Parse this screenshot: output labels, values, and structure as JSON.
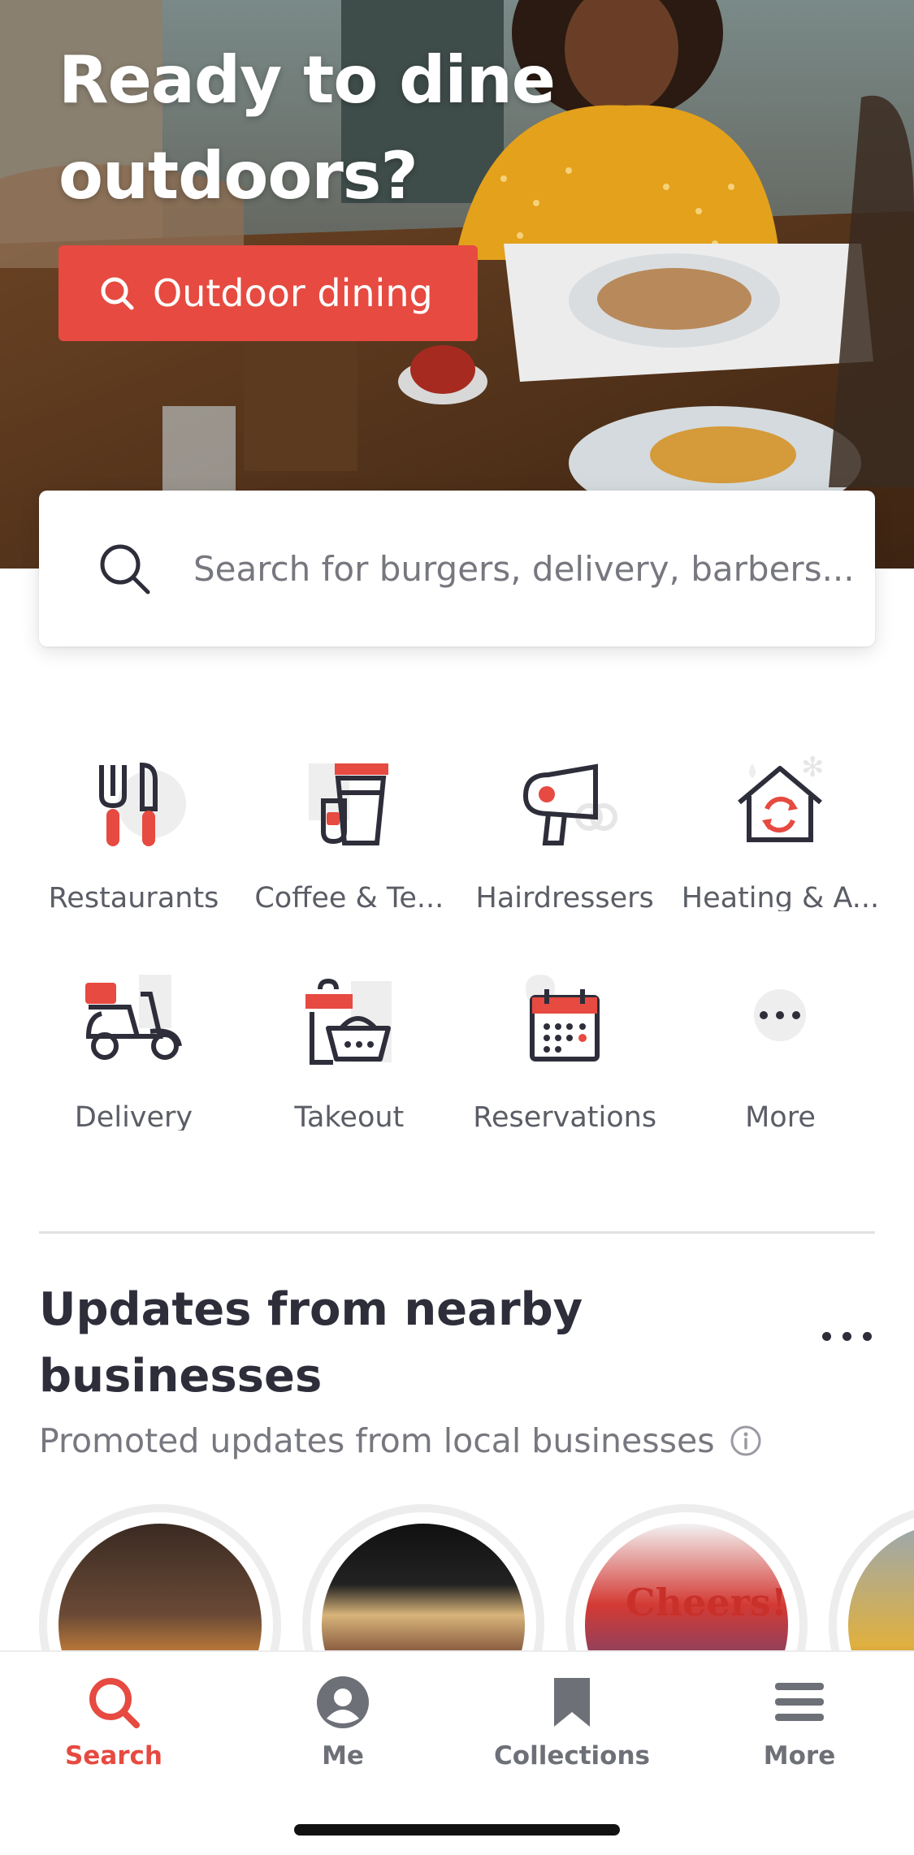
{
  "hero": {
    "title": "Ready to dine outdoors?",
    "button_label": "Outdoor dining",
    "button_icon": "search-icon"
  },
  "search": {
    "placeholder": "Search for burgers, delivery, barbers...",
    "icon": "search-icon"
  },
  "categories": [
    {
      "label": "Restaurants",
      "icon": "fork-knife-icon"
    },
    {
      "label": "Coffee & Te...",
      "icon": "coffee-cup-icon"
    },
    {
      "label": "Hairdressers",
      "icon": "hair-dryer-icon"
    },
    {
      "label": "Heating & A...",
      "icon": "house-refresh-icon"
    },
    {
      "label": "Delivery",
      "icon": "scooter-icon"
    },
    {
      "label": "Takeout",
      "icon": "takeout-basket-icon"
    },
    {
      "label": "Reservations",
      "icon": "calendar-icon"
    },
    {
      "label": "More",
      "icon": "more-dots-icon"
    }
  ],
  "updates": {
    "title": "Updates from nearby businesses",
    "subtitle": "Promoted updates from local businesses",
    "story_text": "Cheers!"
  },
  "tabs": [
    {
      "label": "Search",
      "icon": "search-icon",
      "active": true
    },
    {
      "label": "Me",
      "icon": "user-icon",
      "active": false
    },
    {
      "label": "Collections",
      "icon": "bookmark-icon",
      "active": false
    },
    {
      "label": "More",
      "icon": "menu-icon",
      "active": false
    }
  ],
  "colors": {
    "accent": "#e64a40",
    "text_dark": "#2d2e3a",
    "text_muted": "#77787f"
  }
}
